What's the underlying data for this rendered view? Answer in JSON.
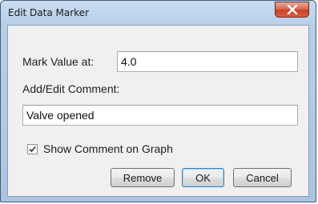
{
  "window": {
    "title": "Edit Data Marker",
    "close_icon": "close-x-icon"
  },
  "form": {
    "mark_value_label": "Mark Value at:",
    "mark_value": "4.0",
    "comment_label": "Add/Edit Comment:",
    "comment_value": "Valve opened",
    "show_comment_label": "Show Comment on Graph",
    "show_comment_checked": true
  },
  "buttons": {
    "remove": "Remove",
    "ok": "OK",
    "cancel": "Cancel"
  },
  "colors": {
    "frame": "#b7cfe8",
    "close_button": "#c7412a",
    "dialog_background": "#f0f0f0"
  }
}
